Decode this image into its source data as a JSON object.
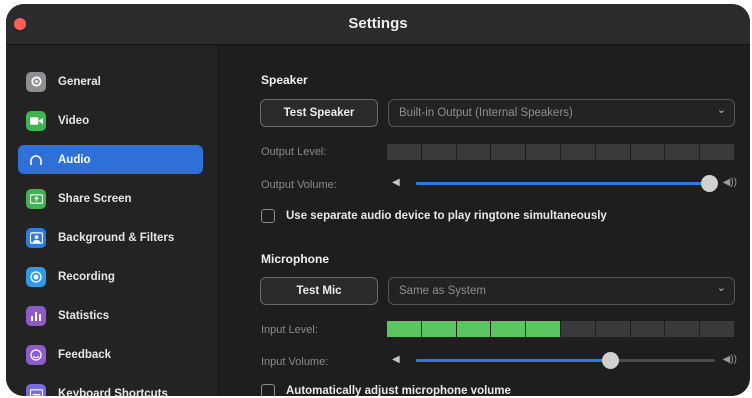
{
  "window": {
    "title": "Settings"
  },
  "sidebar": {
    "items": [
      {
        "label": "General",
        "icon": "gear-icon",
        "color": "#8e8e93"
      },
      {
        "label": "Video",
        "icon": "video-camera-icon",
        "color": "#3cb450"
      },
      {
        "label": "Audio",
        "icon": "headphones-icon",
        "color": "#2f6fd8",
        "active": true
      },
      {
        "label": "Share Screen",
        "icon": "share-screen-icon",
        "color": "#3cb450"
      },
      {
        "label": "Background & Filters",
        "icon": "background-icon",
        "color": "#2f7ae5"
      },
      {
        "label": "Recording",
        "icon": "record-icon",
        "color": "#2f9be5"
      },
      {
        "label": "Statistics",
        "icon": "bar-chart-icon",
        "color": "#8e5cc8"
      },
      {
        "label": "Feedback",
        "icon": "smile-icon",
        "color": "#8e5cc8"
      },
      {
        "label": "Keyboard Shortcuts",
        "icon": "keyboard-icon",
        "color": "#7b6be0"
      }
    ]
  },
  "speaker": {
    "section_title": "Speaker",
    "test_button": "Test Speaker",
    "device": "Built-in Output (Internal Speakers)",
    "output_level_label": "Output Level:",
    "output_level_fraction": 0.0,
    "output_volume_label": "Output Volume:",
    "output_volume_fraction": 0.98,
    "ringtone_checkbox": "Use separate audio device to play ringtone simultaneously",
    "ringtone_checked": false
  },
  "microphone": {
    "section_title": "Microphone",
    "test_button": "Test Mic",
    "device": "Same as System",
    "input_level_label": "Input Level:",
    "input_level_fraction": 0.5,
    "input_volume_label": "Input Volume:",
    "input_volume_fraction": 0.65,
    "auto_adjust_checkbox": "Automatically adjust microphone volume",
    "auto_adjust_checked": false
  },
  "colors": {
    "accent": "#2f6fd8",
    "level_on": "#5dc560"
  }
}
